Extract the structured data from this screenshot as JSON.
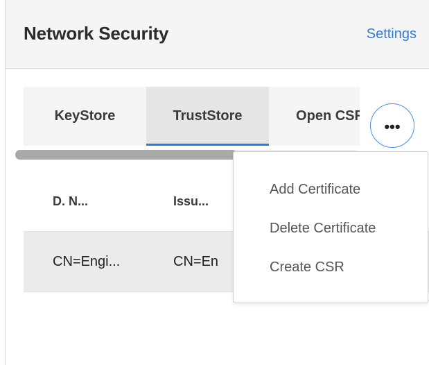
{
  "header": {
    "title": "Network Security",
    "settings_label": "Settings"
  },
  "tabs": [
    {
      "label": "KeyStore",
      "active": false
    },
    {
      "label": "TrustStore",
      "active": true
    },
    {
      "label": "Open CSR",
      "active": false
    }
  ],
  "more_button": {
    "label": "•••"
  },
  "table": {
    "columns": [
      "D. N...",
      "Issu..."
    ],
    "rows": [
      [
        "CN=Engi...",
        "CN=En"
      ]
    ]
  },
  "menu": {
    "items": [
      "Add Certificate",
      "Delete Certificate",
      "Create CSR"
    ]
  },
  "colors": {
    "accent": "#2f7bd2"
  },
  "icons": {
    "more": "more-horizontal-icon"
  }
}
